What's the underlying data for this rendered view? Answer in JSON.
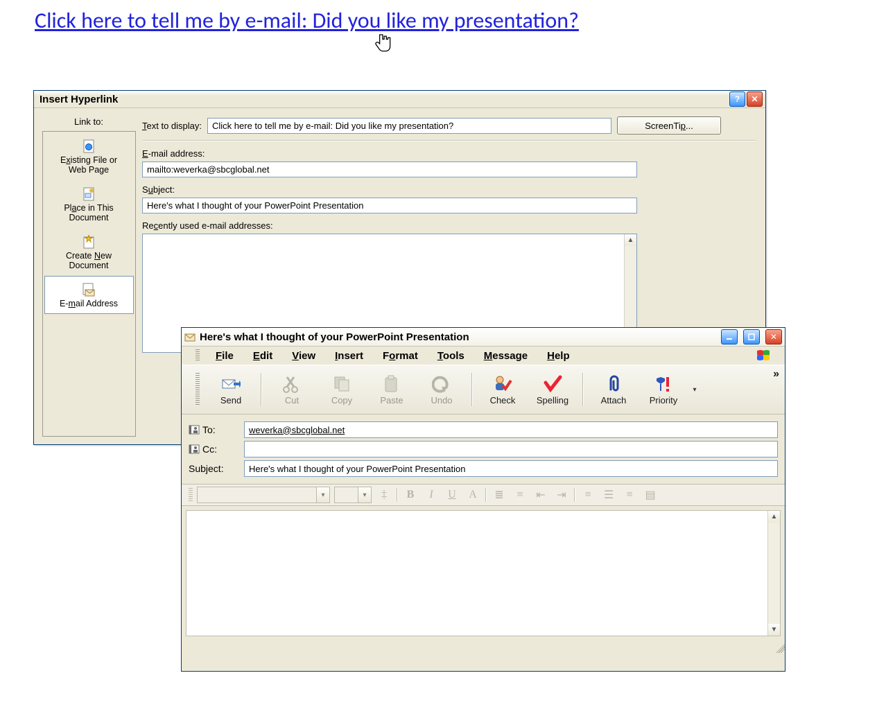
{
  "hyperlink_text": "Click here to tell me by e-mail: Did you like my presentation?",
  "dlg": {
    "title": "Insert Hyperlink",
    "linkto_label": "Link to:",
    "items": {
      "existing": "Existing File or\nWeb Page",
      "place": "Place in This\nDocument",
      "newdoc": "Create New\nDocument",
      "email": "E-mail Address"
    },
    "text_to_display_label": "Text to display:",
    "text_to_display_value": "Click here to tell me by e-mail: Did you like my presentation?",
    "screentip_btn": "ScreenTip...",
    "email_label": "E-mail address:",
    "email_value": "mailto:weverka@sbcglobal.net",
    "subject_label": "Subject:",
    "subject_value": "Here's what I thought of your PowerPoint Presentation",
    "recent_label": "Recently used e-mail addresses:"
  },
  "oe": {
    "title": "Here's what I thought of your PowerPoint Presentation",
    "menu": {
      "file": "File",
      "edit": "Edit",
      "view": "View",
      "insert": "Insert",
      "format": "Format",
      "tools": "Tools",
      "message": "Message",
      "help": "Help"
    },
    "toolbar": {
      "send": "Send",
      "cut": "Cut",
      "copy": "Copy",
      "paste": "Paste",
      "undo": "Undo",
      "check": "Check",
      "spelling": "Spelling",
      "attach": "Attach",
      "priority": "Priority"
    },
    "to_label": "To:",
    "to_value": "weverka@sbcglobal.net",
    "cc_label": "Cc:",
    "cc_value": "",
    "subject_label": "Subject:",
    "subject_value": "Here's what I thought of your PowerPoint Presentation",
    "format_labels": {
      "b": "B",
      "i": "I",
      "u": "U",
      "a": "A"
    }
  }
}
